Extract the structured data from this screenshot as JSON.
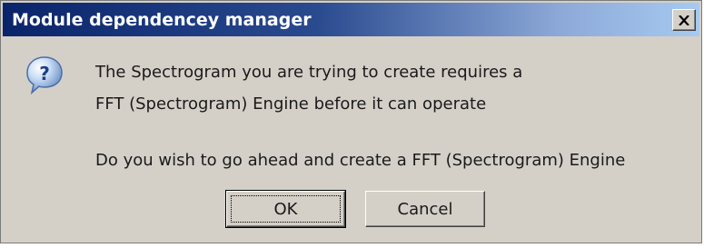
{
  "window": {
    "title": "Module dependencey manager",
    "close_icon": "close-icon"
  },
  "dialog": {
    "icon": "question-icon",
    "icon_glyph": "?",
    "message_lines": [
      "The Spectrogram you are trying to create requires a",
      "FFT (Spectrogram) Engine before it can operate",
      "Do you wish to go ahead and create a FFT (Spectrogram) Engine"
    ]
  },
  "buttons": {
    "ok_label": "OK",
    "cancel_label": "Cancel"
  },
  "colors": {
    "titlebar_start": "#0a246a",
    "titlebar_end": "#a6caf0",
    "dialog_bg": "#d4d0c8"
  }
}
